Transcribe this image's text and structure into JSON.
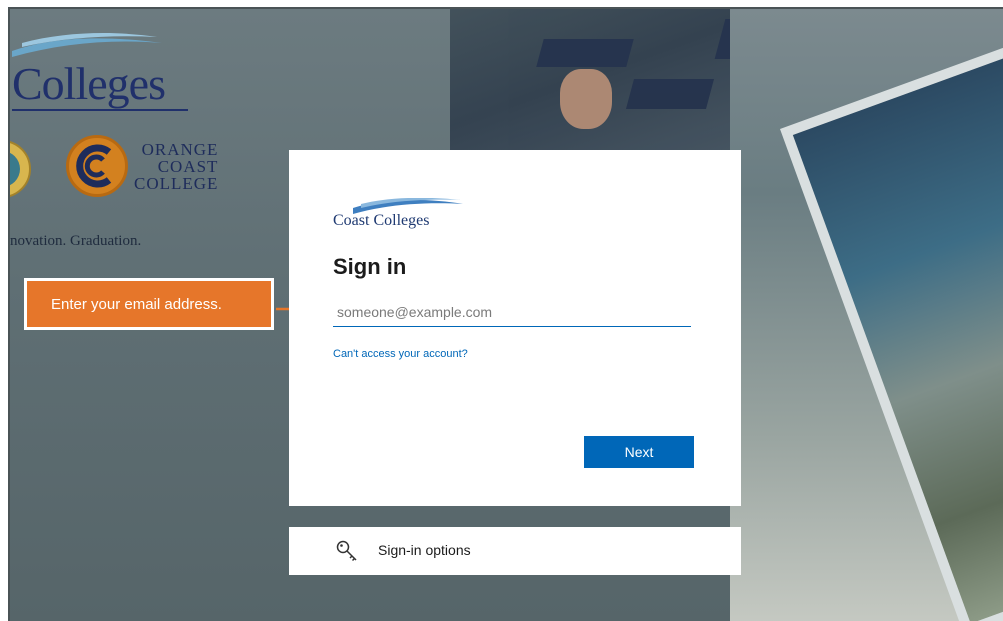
{
  "background": {
    "brand_name": "Colleges",
    "occ_lines": [
      "ORANGE",
      "COAST",
      "COLLEGE"
    ],
    "tagline": "novation. Graduation."
  },
  "callout": {
    "text": "Enter your email address."
  },
  "signin": {
    "logo_text": "Coast Colleges",
    "title": "Sign in",
    "email_placeholder": "someone@example.com",
    "email_value": "",
    "cant_access_link": "Can't access your account?",
    "next_button": "Next"
  },
  "options": {
    "icon": "key-icon",
    "label": "Sign-in options"
  },
  "colors": {
    "accent": "#0067b8",
    "callout": "#e6762a",
    "brand_navy": "#20306b"
  }
}
